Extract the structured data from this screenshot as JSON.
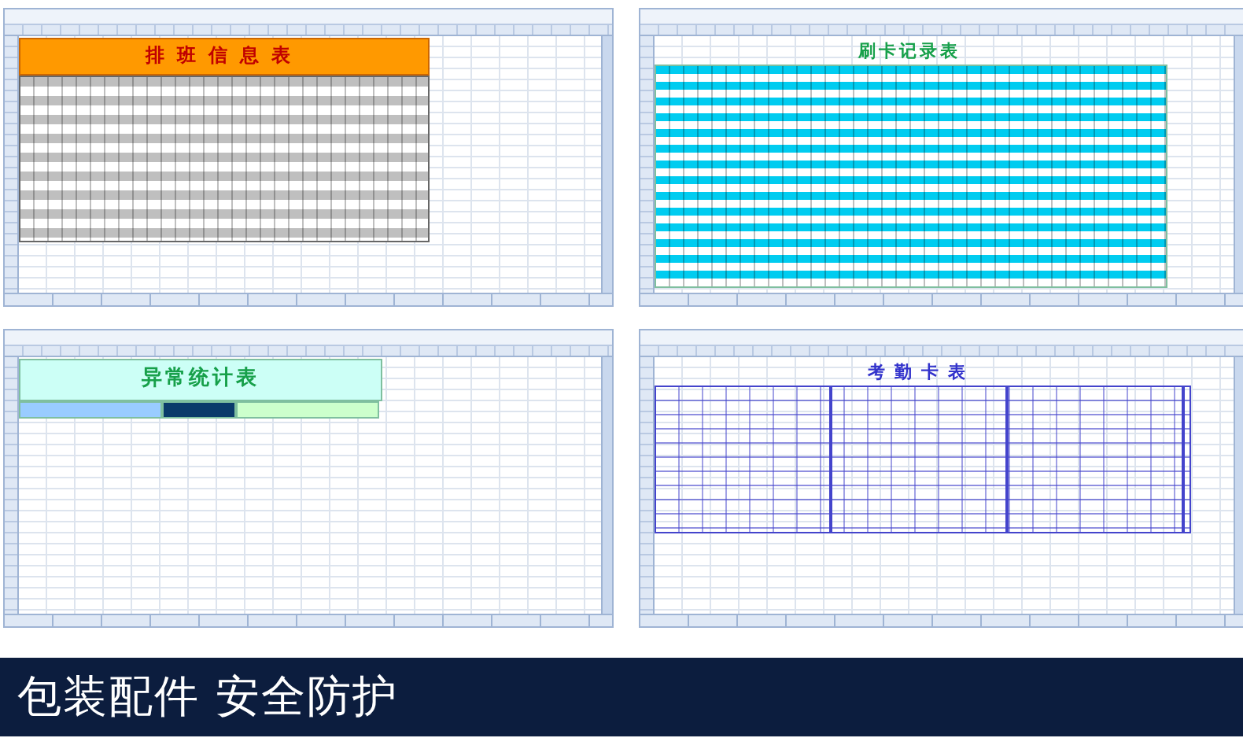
{
  "panels": [
    {
      "kind": "schedule",
      "title": "排班信息表"
    },
    {
      "kind": "swipe",
      "title": "刷卡记录表"
    },
    {
      "kind": "exceptions",
      "title": "异常统计表"
    },
    {
      "kind": "timecard",
      "title": "考勤卡表"
    }
  ],
  "banner": {
    "text": "包装配件 安全防护"
  }
}
